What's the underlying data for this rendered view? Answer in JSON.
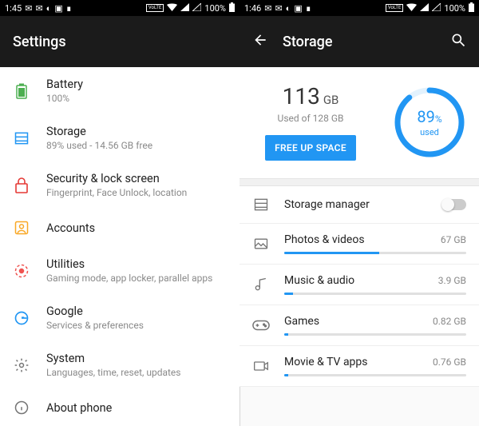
{
  "left": {
    "statusbar": {
      "time": "1:45",
      "battery": "100%",
      "volte": "VoLTE"
    },
    "title": "Settings",
    "items": [
      {
        "icon": "battery-icon",
        "color": "#4caf50",
        "label": "Battery",
        "sub": "100%"
      },
      {
        "icon": "storage-icon",
        "color": "#2196f3",
        "label": "Storage",
        "sub": "89% used - 14.56 GB free"
      },
      {
        "icon": "lock-icon",
        "color": "#e53935",
        "label": "Security & lock screen",
        "sub": "Fingerprint, Face Unlock, location"
      },
      {
        "icon": "account-icon",
        "color": "#f9a825",
        "label": "Accounts",
        "sub": ""
      },
      {
        "icon": "utilities-icon",
        "color": "#ef5350",
        "label": "Utilities",
        "sub": "Gaming mode, app locker, parallel apps"
      },
      {
        "icon": "google-icon",
        "color": "#2196f3",
        "label": "Google",
        "sub": "Services & preferences"
      },
      {
        "icon": "system-icon",
        "color": "#757575",
        "label": "System",
        "sub": "Languages, time, reset, updates"
      },
      {
        "icon": "about-icon",
        "color": "#757575",
        "label": "About phone",
        "sub": ""
      }
    ]
  },
  "right": {
    "statusbar": {
      "time": "1:46",
      "battery": "100%",
      "volte": "VoLTE"
    },
    "title": "Storage",
    "hero": {
      "used_value": "113",
      "used_unit": "GB",
      "total_line": "Used of 128 GB",
      "button": "FREE UP SPACE",
      "ring_pct": 89,
      "ring_label": "used"
    },
    "manager": {
      "label": "Storage manager",
      "enabled": false
    },
    "categories": [
      {
        "icon": "photos-icon",
        "label": "Photos & videos",
        "value": "67 GB",
        "fill": 52
      },
      {
        "icon": "music-icon",
        "label": "Music & audio",
        "value": "3.9 GB",
        "fill": 5
      },
      {
        "icon": "games-icon",
        "label": "Games",
        "value": "0.82 GB",
        "fill": 2
      },
      {
        "icon": "movie-icon",
        "label": "Movie & TV apps",
        "value": "0.76 GB",
        "fill": 2
      }
    ]
  }
}
